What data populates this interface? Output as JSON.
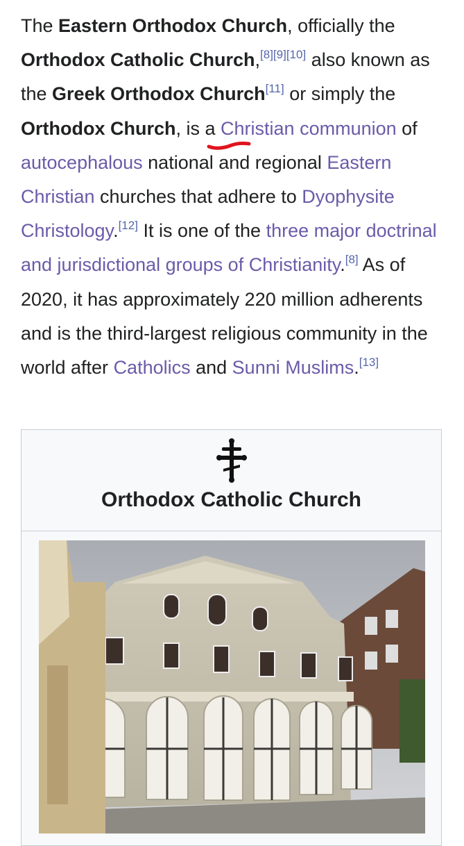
{
  "article": {
    "t1": "The ",
    "b1": "Eastern Orthodox Church",
    "t2": ", officially the ",
    "b2": "Orthodox Catholic Church",
    "t3": ",",
    "ref_8": "[8]",
    "ref_9": "[9]",
    "ref_10": "[10]",
    "t4": " also known as the ",
    "b3": "Greek Orthodox Church",
    "ref_11": "[11]",
    "t5": " or simply the ",
    "b4": "Orthodox Church",
    "t6": ", is a ",
    "link_christian_communion": "Christian communion",
    "t7": " of ",
    "link_autocephalous": "autocephalous",
    "t8": " national and regional ",
    "link_eastern_christian": "Eastern Christian",
    "t9": " churches that adhere to ",
    "link_dyophysite": "Dyophysite Christology",
    "t10": ".",
    "ref_12": "[12]",
    "t11": " It is one of the ",
    "link_three_groups": "three major doctrinal and jurisdictional groups of Christianity",
    "t12": ".",
    "ref_8b": "[8]",
    "t13": " As of 2020, it has approximately 220 million adherents and is the third-largest religious community in the world after ",
    "link_catholics": "Catholics",
    "t14": " and ",
    "link_sunni": "Sunni Muslims",
    "t15": ".",
    "ref_13": "[13]"
  },
  "infobox": {
    "title": "Orthodox Catholic Church",
    "emblem_icon": "orthodox-cross-icon",
    "image_subject": "church-building-photo"
  },
  "colors": {
    "link": "#6b5ba8",
    "ref": "#5566aa",
    "text": "#202122",
    "annotation": "#e0141e",
    "border": "#c8ccd1"
  }
}
